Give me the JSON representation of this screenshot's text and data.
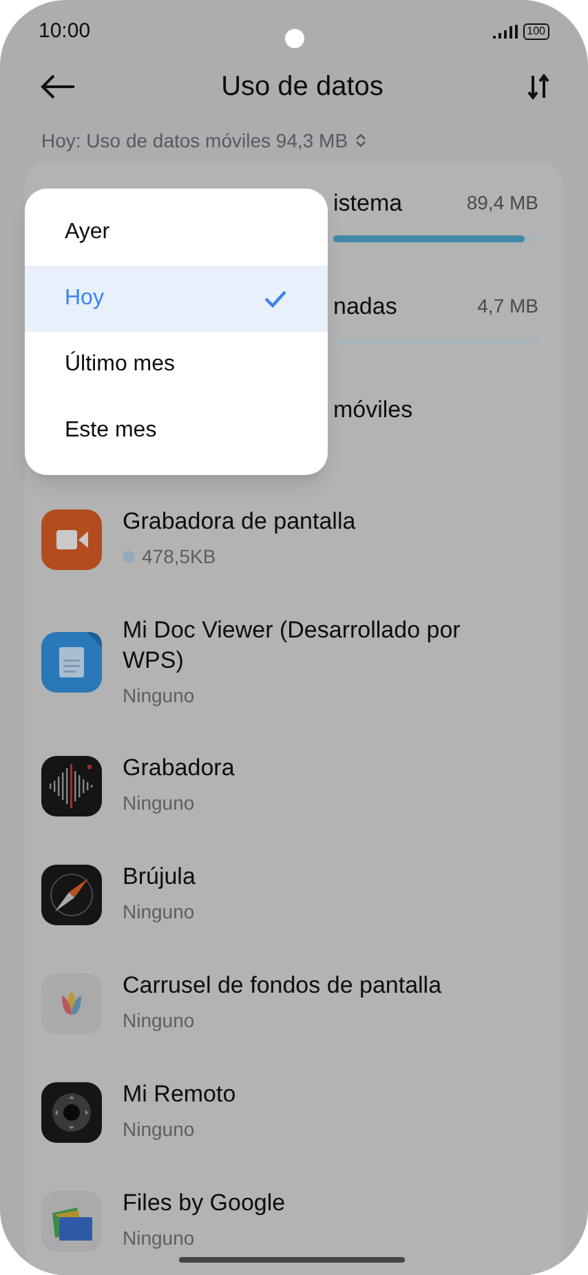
{
  "status_bar": {
    "time": "10:00",
    "battery": "100"
  },
  "header": {
    "title": "Uso de datos"
  },
  "period_selector": {
    "label": "Hoy: Uso de datos móviles 94,3 MB"
  },
  "partial_rows": [
    {
      "name": "istema",
      "value": "89,4 MB",
      "level": 0.93
    },
    {
      "name": "nadas",
      "value": "4,7 MB"
    },
    {
      "name": "móviles"
    }
  ],
  "apps": [
    {
      "name": "Grabadora de pantalla",
      "usage": "478,5KB",
      "dot": true
    },
    {
      "name": "Mi Doc Viewer (Desarrollado por WPS)",
      "usage": "Ninguno",
      "dot": false
    },
    {
      "name": "Grabadora",
      "usage": "Ninguno",
      "dot": false
    },
    {
      "name": "Brújula",
      "usage": "Ninguno",
      "dot": false
    },
    {
      "name": "Carrusel de fondos de pantalla",
      "usage": "Ninguno",
      "dot": false
    },
    {
      "name": "Mi Remoto",
      "usage": "Ninguno",
      "dot": false
    },
    {
      "name": "Files by Google",
      "usage": "Ninguno",
      "dot": false
    }
  ],
  "period_menu": [
    {
      "label": "Ayer",
      "selected": false
    },
    {
      "label": "Hoy",
      "selected": true
    },
    {
      "label": "Último mes",
      "selected": false
    },
    {
      "label": "Este mes",
      "selected": false
    }
  ]
}
